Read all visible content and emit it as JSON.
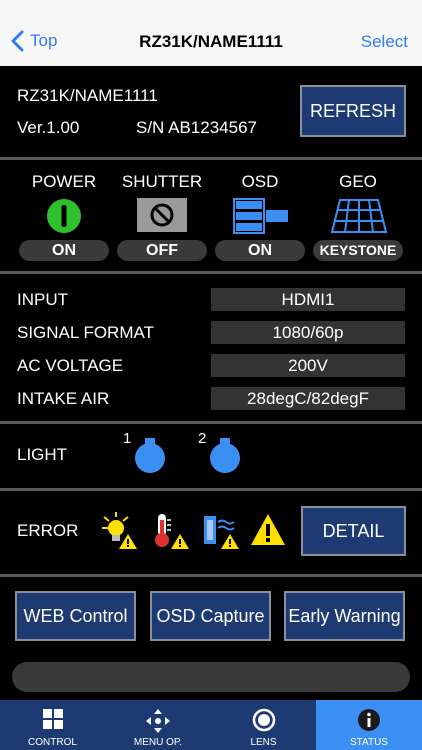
{
  "nav": {
    "back_label": "Top",
    "title": "RZ31K/NAME1111",
    "select_label": "Select"
  },
  "device": {
    "name": "RZ31K/NAME1111",
    "version": "Ver.1.00",
    "serial": "S/N AB1234567",
    "refresh_label": "REFRESH"
  },
  "status": [
    {
      "label": "POWER",
      "value": "ON"
    },
    {
      "label": "SHUTTER",
      "value": "OFF"
    },
    {
      "label": "OSD",
      "value": "ON"
    },
    {
      "label": "GEO",
      "value": "KEYSTONE"
    }
  ],
  "info": [
    {
      "label": "INPUT",
      "value": "HDMI1"
    },
    {
      "label": "SIGNAL FORMAT",
      "value": "1080/60p"
    },
    {
      "label": "AC VOLTAGE",
      "value": "200V"
    },
    {
      "label": "INTAKE AIR",
      "value": "28degC/82degF"
    }
  ],
  "light": {
    "label": "LIGHT",
    "lamps": [
      "1",
      "2"
    ]
  },
  "error": {
    "label": "ERROR",
    "detail_label": "DETAIL"
  },
  "buttons": {
    "web_control": "WEB Control",
    "osd_capture": "OSD Capture",
    "early_warning": "Early Warning"
  },
  "message": "",
  "tabs": [
    {
      "label": "CONTROL",
      "icon": "grid-icon"
    },
    {
      "label": "MENU OP.",
      "icon": "move-arrows-icon"
    },
    {
      "label": "LENS",
      "icon": "lens-icon"
    },
    {
      "label": "STATUS",
      "icon": "info-icon",
      "active": true
    }
  ],
  "colors": {
    "accent": "#2e7cf6",
    "button": "#1e3a72",
    "active_tab": "#3b8ff2",
    "power_on": "#2fbf2f",
    "osd_blue": "#3b8ff2",
    "warning": "#ffe000"
  }
}
